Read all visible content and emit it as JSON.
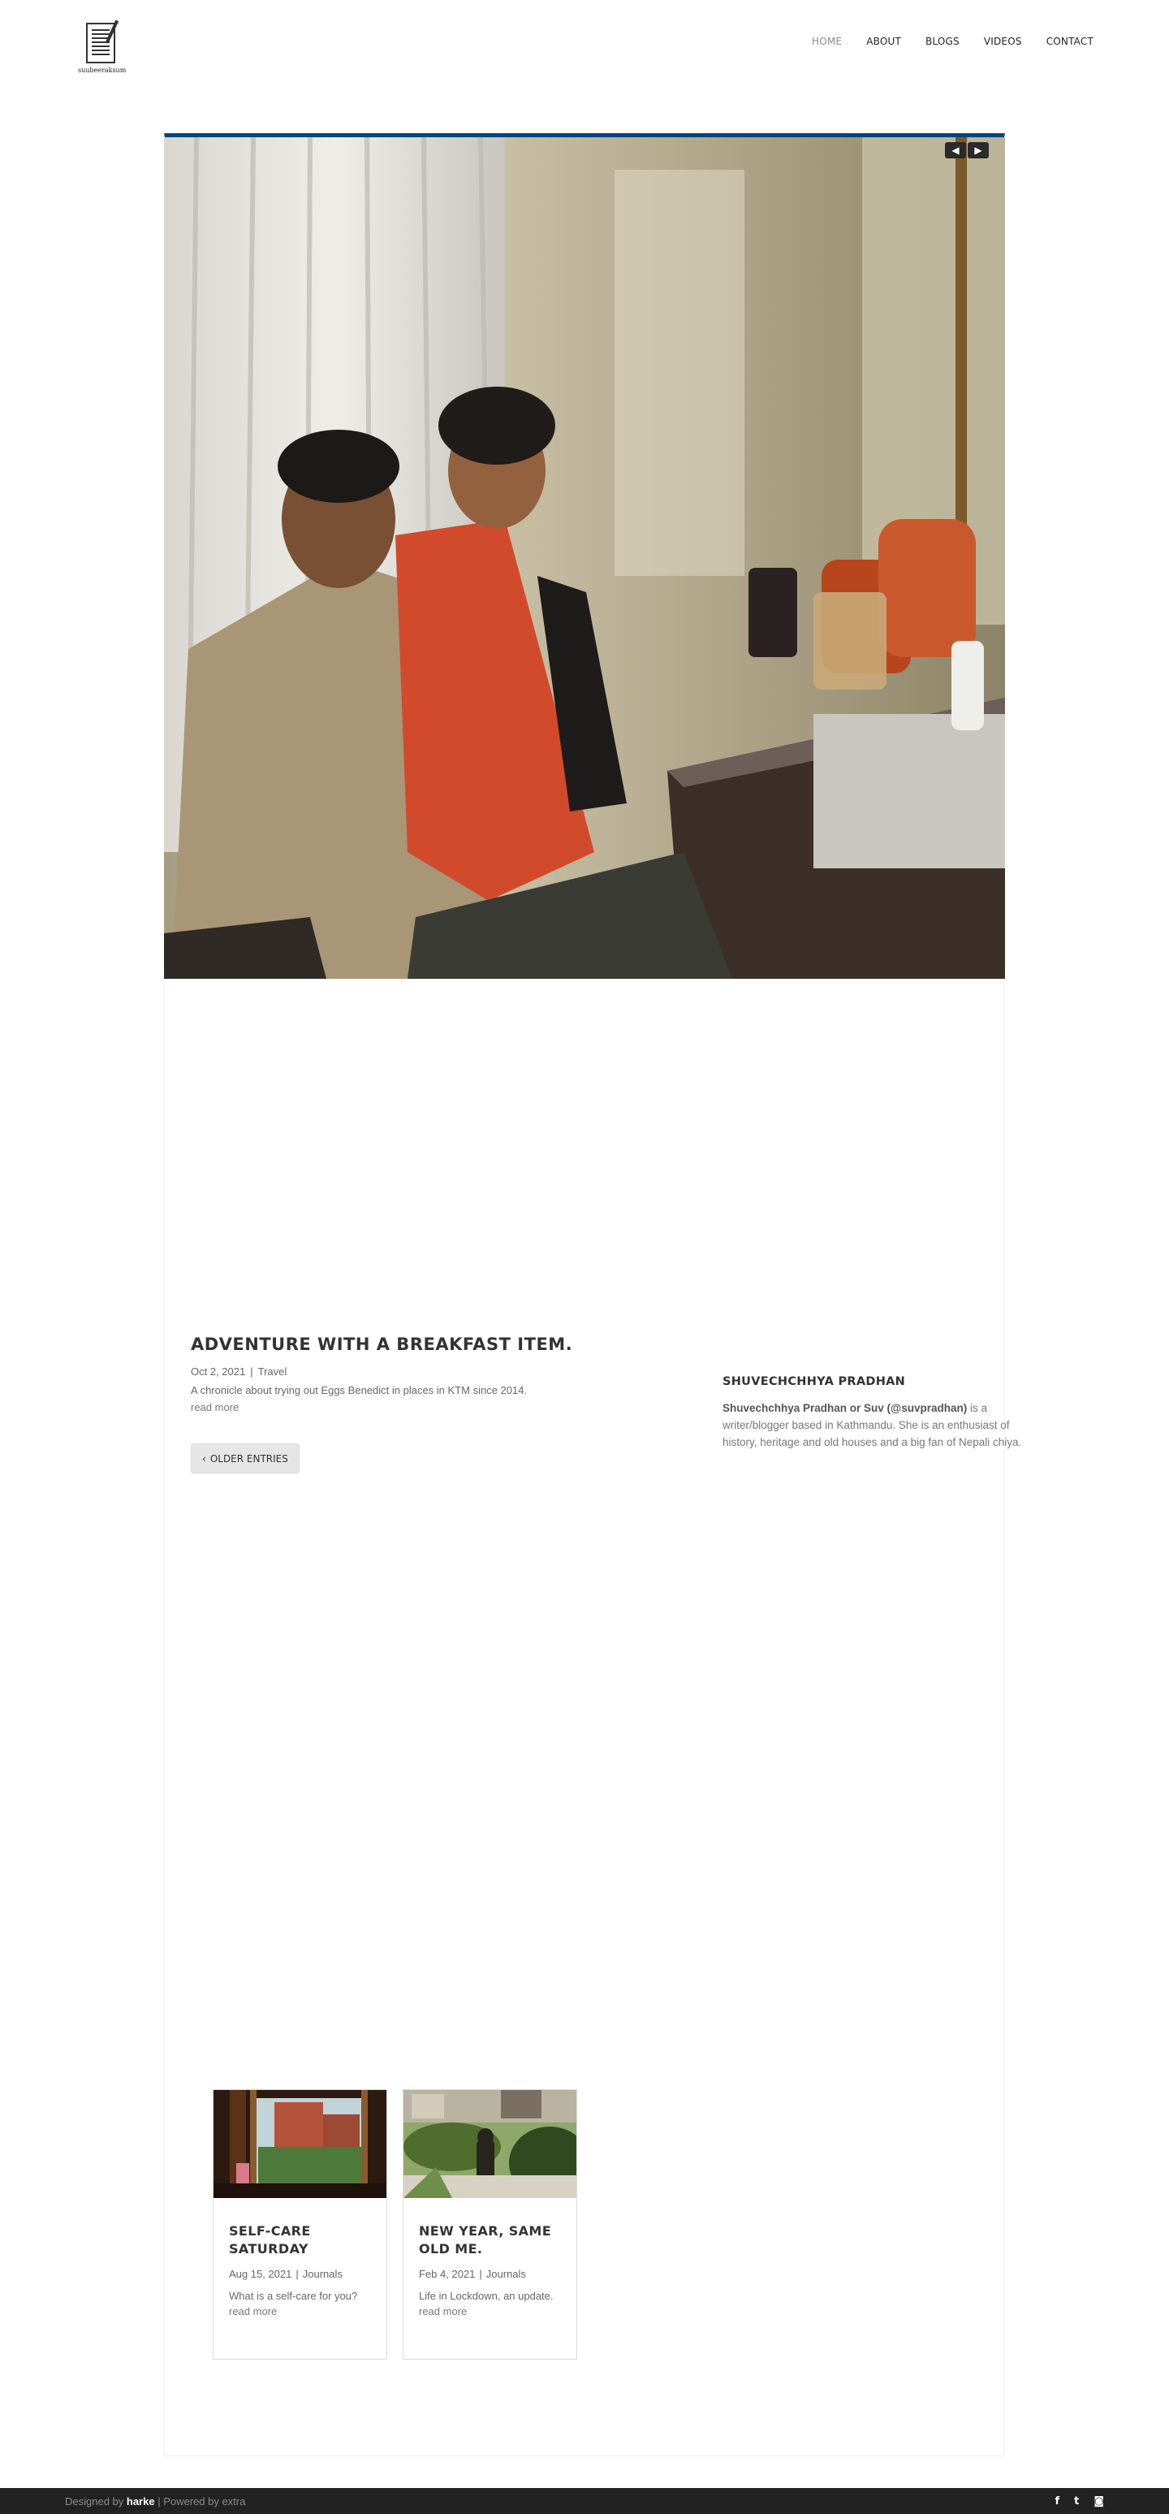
{
  "header": {
    "logo_text": "suubeeraksum",
    "nav": [
      {
        "label": "HOME",
        "active": true
      },
      {
        "label": "ABOUT"
      },
      {
        "label": "BLOGS"
      },
      {
        "label": "VIDEOS"
      },
      {
        "label": "CONTACT"
      }
    ]
  },
  "slider": {
    "prev_icon": "◀",
    "next_icon": "▶"
  },
  "post": {
    "title": "ADVENTURE WITH A BREAKFAST ITEM.",
    "date": "Oct 2, 2021",
    "separator": "|",
    "category": "Travel",
    "excerpt": "A chronicle about trying out Eggs Benedict in places in KTM since 2014.",
    "read_more": "read more"
  },
  "pagination": {
    "older_label": "OLDER ENTRIES",
    "icon": "‹"
  },
  "sidebar": {
    "title": "SHUVECHCHHYA PRADHAN",
    "bold_name": "Shuvechchhya Pradhan or Suv (@suvpradhan)",
    "bio": " is a writer/blogger based in Kathmandu. She is an enthusiast of history, heritage and old houses and a big fan of Nepali chiya."
  },
  "related": [
    {
      "title": "SELF-CARE SATURDAY",
      "date": "Aug 15, 2021",
      "separator": "|",
      "category": "Journals",
      "excerpt": "What is a self-care for you?",
      "read_more": "read more"
    },
    {
      "title": "NEW YEAR, SAME OLD ME.",
      "date": "Feb 4, 2021",
      "separator": "|",
      "category": "Journals",
      "excerpt": "Life in Lockdown, an update.",
      "read_more": "read more"
    }
  ],
  "footer": {
    "designed_by": "Designed by ",
    "designer": "harke",
    "powered": " | Powered by extra",
    "social": [
      "f",
      "t",
      "◙"
    ]
  },
  "colors": {
    "accent": "#00457c",
    "footer_bg": "#222222"
  }
}
